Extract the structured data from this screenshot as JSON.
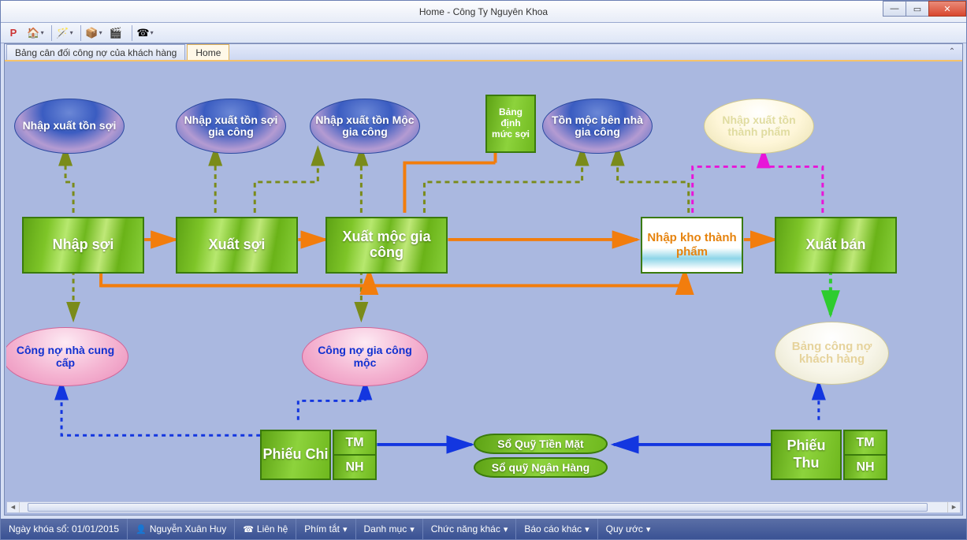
{
  "window": {
    "title": "Home - Công Ty Nguyên Khoa"
  },
  "tabs": {
    "t0": "Bảng cân đối công nợ của khách hàng",
    "t1": "Home"
  },
  "nodes": {
    "nxts": "Nhập xuất tồn sợi",
    "nxtsgc": "Nhập xuất tồn sợi gia công",
    "nxtmgc": "Nhập xuất tồn Mộc gia công",
    "bdms": "Bảng định mức sợi",
    "tmbngc": "Tồn mộc bên nhà gia công",
    "nxttp": "Nhập xuất tồn thành phẩm",
    "nhapsoi": "Nhập sợi",
    "xuatsoi": "Xuất sợi",
    "xmgc": "Xuất mộc gia công",
    "nktp": "Nhập kho thành phẩm",
    "xuatban": "Xuất bán",
    "cnncc": "Công nợ nhà cung cấp",
    "cngcm": "Công nợ gia công mộc",
    "bcnkh": "Bảng công nợ khách hàng",
    "phieuchi": "Phiếu Chi",
    "phieuthu": "Phiếu Thu",
    "tm": "TM",
    "nh": "NH",
    "sqtm": "Sổ Quỹ Tiền Mặt",
    "sqnh": "Sổ quỹ Ngân Hàng"
  },
  "status": {
    "date": "Ngày khóa sổ: 01/01/2015",
    "user": "Nguyễn Xuân Huy",
    "lienhe": "Liên hệ",
    "phimtat": "Phím tắt",
    "danhmuc": "Danh mục",
    "cnkhac": "Chức năng khác",
    "bckhac": "Báo cáo khác",
    "quyuoc": "Quy ước"
  }
}
